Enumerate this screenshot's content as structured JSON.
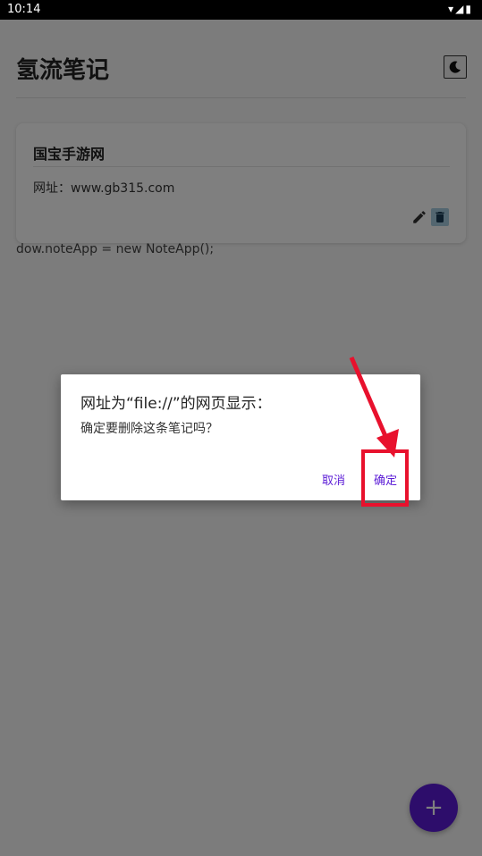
{
  "status_bar": {
    "time": "10:14",
    "icons": [
      "wifi-icon",
      "signal-icon",
      "battery-icon"
    ]
  },
  "app": {
    "title": "氢流笔记",
    "theme_toggle_icon": "moon-icon"
  },
  "notes": [
    {
      "title": "国宝手游网",
      "content": "网址：www.gb315.com",
      "actions": [
        "edit-icon",
        "delete-icon"
      ]
    }
  ],
  "stray_text": "dow.noteApp = new NoteApp();",
  "fab": {
    "label": "+"
  },
  "dialog": {
    "title": "网址为“file://”的网页显示：",
    "message": "确定要删除这条笔记吗？",
    "cancel_label": "取消",
    "ok_label": "确定"
  },
  "colors": {
    "accent": "#5b1bd6",
    "annotation": "#e8112d",
    "overlay": "rgba(0,0,0,0.5)"
  }
}
